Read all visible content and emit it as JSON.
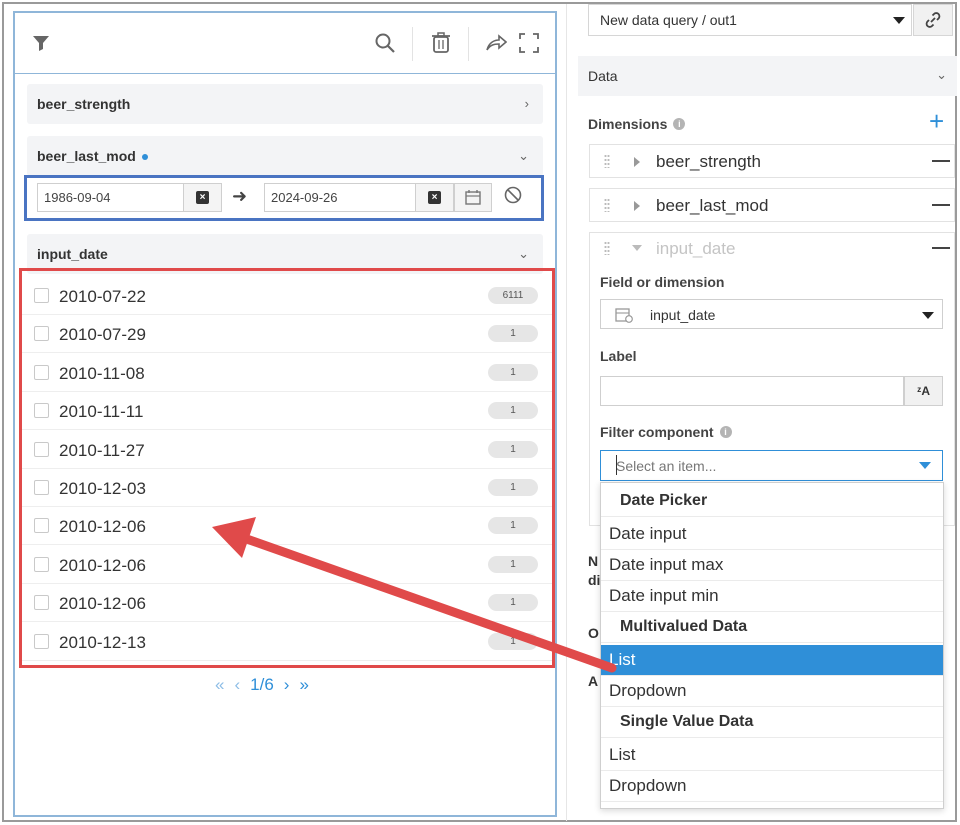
{
  "filter_panel": {
    "sections": [
      {
        "label": "beer_strength"
      },
      {
        "label": "beer_last_mod"
      },
      {
        "label": "input_date"
      }
    ],
    "date_range": {
      "from": "1986-09-04",
      "to": "2024-09-26"
    },
    "date_items": [
      {
        "date": "2010-07-22",
        "count": "6111"
      },
      {
        "date": "2010-07-29",
        "count": "1"
      },
      {
        "date": "2010-11-08",
        "count": "1"
      },
      {
        "date": "2010-11-11",
        "count": "1"
      },
      {
        "date": "2010-11-27",
        "count": "1"
      },
      {
        "date": "2010-12-03",
        "count": "1"
      },
      {
        "date": "2010-12-06",
        "count": "1"
      },
      {
        "date": "2010-12-06",
        "count": "1"
      },
      {
        "date": "2010-12-06",
        "count": "1"
      },
      {
        "date": "2010-12-13",
        "count": "1"
      }
    ],
    "pager": {
      "first": "«",
      "prev": "‹",
      "page": "1/6",
      "next": "›",
      "last": "»"
    }
  },
  "config_panel": {
    "query": "New data query / out1",
    "data_section": "Data",
    "dimensions_title": "Dimensions",
    "dimensions": [
      {
        "name": "beer_strength"
      },
      {
        "name": "beer_last_mod"
      },
      {
        "name": "input_date"
      }
    ],
    "field_label": "Field or dimension",
    "field_value": "input_date",
    "label_label": "Label",
    "label_value": "",
    "translate_glyph": "ᶻA",
    "filter_component_label": "Filter component",
    "filter_placeholder": "Select an item...",
    "partial_labels": [
      "N",
      "di",
      "O",
      "A"
    ],
    "dropdown": {
      "groups": [
        {
          "title": "Date Picker",
          "items": [
            "Date input",
            "Date input max",
            "Date input min"
          ]
        },
        {
          "title": "Multivalued Data",
          "items": [
            "List",
            "Dropdown"
          ]
        },
        {
          "title": "Single Value Data",
          "items": [
            "List",
            "Dropdown"
          ]
        }
      ],
      "selected": "List"
    }
  },
  "annotation_colors": {
    "date_range_box": "#4a74c2",
    "list_box": "#e04a4a",
    "arrow": "#e04a4a",
    "accent": "#2f8fd8"
  }
}
